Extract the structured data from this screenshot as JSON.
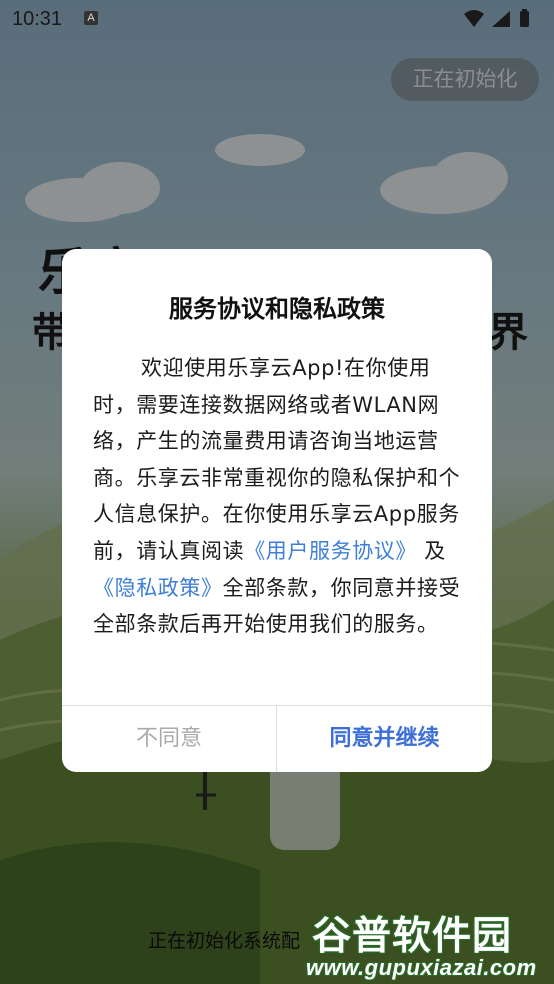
{
  "status_bar": {
    "time": "10:31",
    "notification_icon": "A",
    "icons": [
      "wifi-icon",
      "signal-icon",
      "battery-icon"
    ]
  },
  "splash": {
    "init_badge": "正在初始化",
    "brand_line1": "乐享云",
    "brand_line2_start": "带",
    "brand_line2_end": "界",
    "bottom_status": "正在初始化系统配"
  },
  "dialog": {
    "title": "服务协议和隐私政策",
    "body_intro": "欢迎使用乐享云App!在你使用时，需要连接数据网络或者WLAN网络，产生的流量费用请咨询当地运营商。乐享云非常重视你的隐私保护和个人信息保护。在你使用乐享云App服务前，请认真阅读",
    "user_agreement_link": "《用户服务协议》",
    "conjunction": " 及 ",
    "privacy_policy_link": "《隐私政策》",
    "body_outro": "全部条款，你同意并接受全部条款后再开始使用我们的服务。",
    "disagree_label": "不同意",
    "agree_label": "同意并继续"
  },
  "watermark": {
    "title": "谷普软件园",
    "url": "www.gupuxiazai.com"
  },
  "colors": {
    "link": "#3d7fd8",
    "agree_button": "#3d6fd8",
    "disagree_button": "#aaaaaa"
  }
}
